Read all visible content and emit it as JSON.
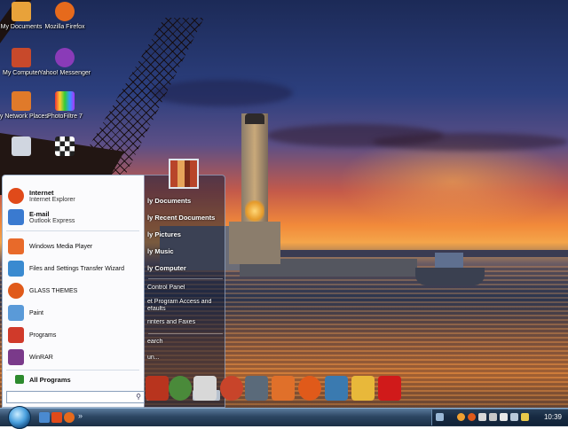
{
  "desktop_icons": [
    {
      "label": "My Documents",
      "icon": "folder-documents-icon",
      "color": "#e8a23a"
    },
    {
      "label": "Mozilla Firefox",
      "icon": "firefox-icon",
      "color": "#e66a1c"
    },
    {
      "label": "My Computer",
      "icon": "computer-icon",
      "color": "#c8492b"
    },
    {
      "label": "Yahoo! Messenger",
      "icon": "yahoo-messenger-icon",
      "color": "#8a3bb8"
    },
    {
      "label": "My Network Places",
      "icon": "network-icon",
      "color": "#e07a2a"
    },
    {
      "label": "PhotoFiltre 7",
      "icon": "photofiltre-icon",
      "color": "#4a9a3a"
    },
    {
      "label": "",
      "icon": "recycle-bin-icon",
      "color": "#d0d6e0"
    },
    {
      "label": "",
      "icon": "checker-app-icon",
      "color": "#f0f0f0"
    }
  ],
  "start_menu": {
    "pinned": [
      {
        "title": "Internet",
        "subtitle": "Internet Explorer",
        "icon": "internet-explorer-icon",
        "color": "#e04a1a"
      },
      {
        "title": "E-mail",
        "subtitle": "Outlook Express",
        "icon": "outlook-express-icon",
        "color": "#3a7ad0"
      }
    ],
    "recent": [
      {
        "label": "Windows Media Player",
        "icon": "media-player-icon",
        "color": "#e86a2a"
      },
      {
        "label": "Files and Settings Transfer Wizard",
        "icon": "transfer-wizard-icon",
        "color": "#3a8ad0"
      },
      {
        "label": "GLASS THEMES",
        "icon": "glass-themes-icon",
        "color": "#e05a1a"
      },
      {
        "label": "Paint",
        "icon": "paint-icon",
        "color": "#5a9ad8"
      },
      {
        "label": "Programs",
        "icon": "programs-icon",
        "color": "#d03a2a"
      },
      {
        "label": "WinRAR",
        "icon": "winrar-icon",
        "color": "#7a3a8a"
      }
    ],
    "all_programs": "All Programs",
    "right_items": [
      "My Documents",
      "My Recent Documents",
      "My Pictures",
      "My Music",
      "My Computer",
      "Control Panel",
      "Set Program Access and Defaults",
      "Printers and Faxes",
      "Search",
      "Run..."
    ],
    "right_visible": [
      "ly Documents",
      "ly Recent Documents",
      "ly Pictures",
      "ly Music",
      "ly Computer",
      "Control Panel",
      "et Program Access and",
      "efaults",
      "rinters and Faxes",
      "earch",
      "un..."
    ],
    "search_placeholder": ""
  },
  "dock": {
    "icons": [
      {
        "icon": "dock-app-red-icon",
        "color": "#b8341e"
      },
      {
        "icon": "dock-globe-icon",
        "color": "#4a8a3a"
      },
      {
        "icon": "dock-flash-icon",
        "color": "#d8d8d8"
      },
      {
        "icon": "dock-disc-icon",
        "color": "#c8442a"
      },
      {
        "icon": "dock-film-icon",
        "color": "#5a6a7a"
      },
      {
        "icon": "dock-photo-icon",
        "color": "#e0702a"
      },
      {
        "icon": "dock-firefox-icon",
        "color": "#e05a1a"
      },
      {
        "icon": "dock-network-icon",
        "color": "#3a7ab0"
      },
      {
        "icon": "dock-paint-icon",
        "color": "#e8b83a"
      },
      {
        "icon": "dock-r-app-icon",
        "color": "#d01a1a"
      }
    ]
  },
  "taskbar": {
    "clock": "10:39",
    "quicklaunch_chevron": "»"
  }
}
